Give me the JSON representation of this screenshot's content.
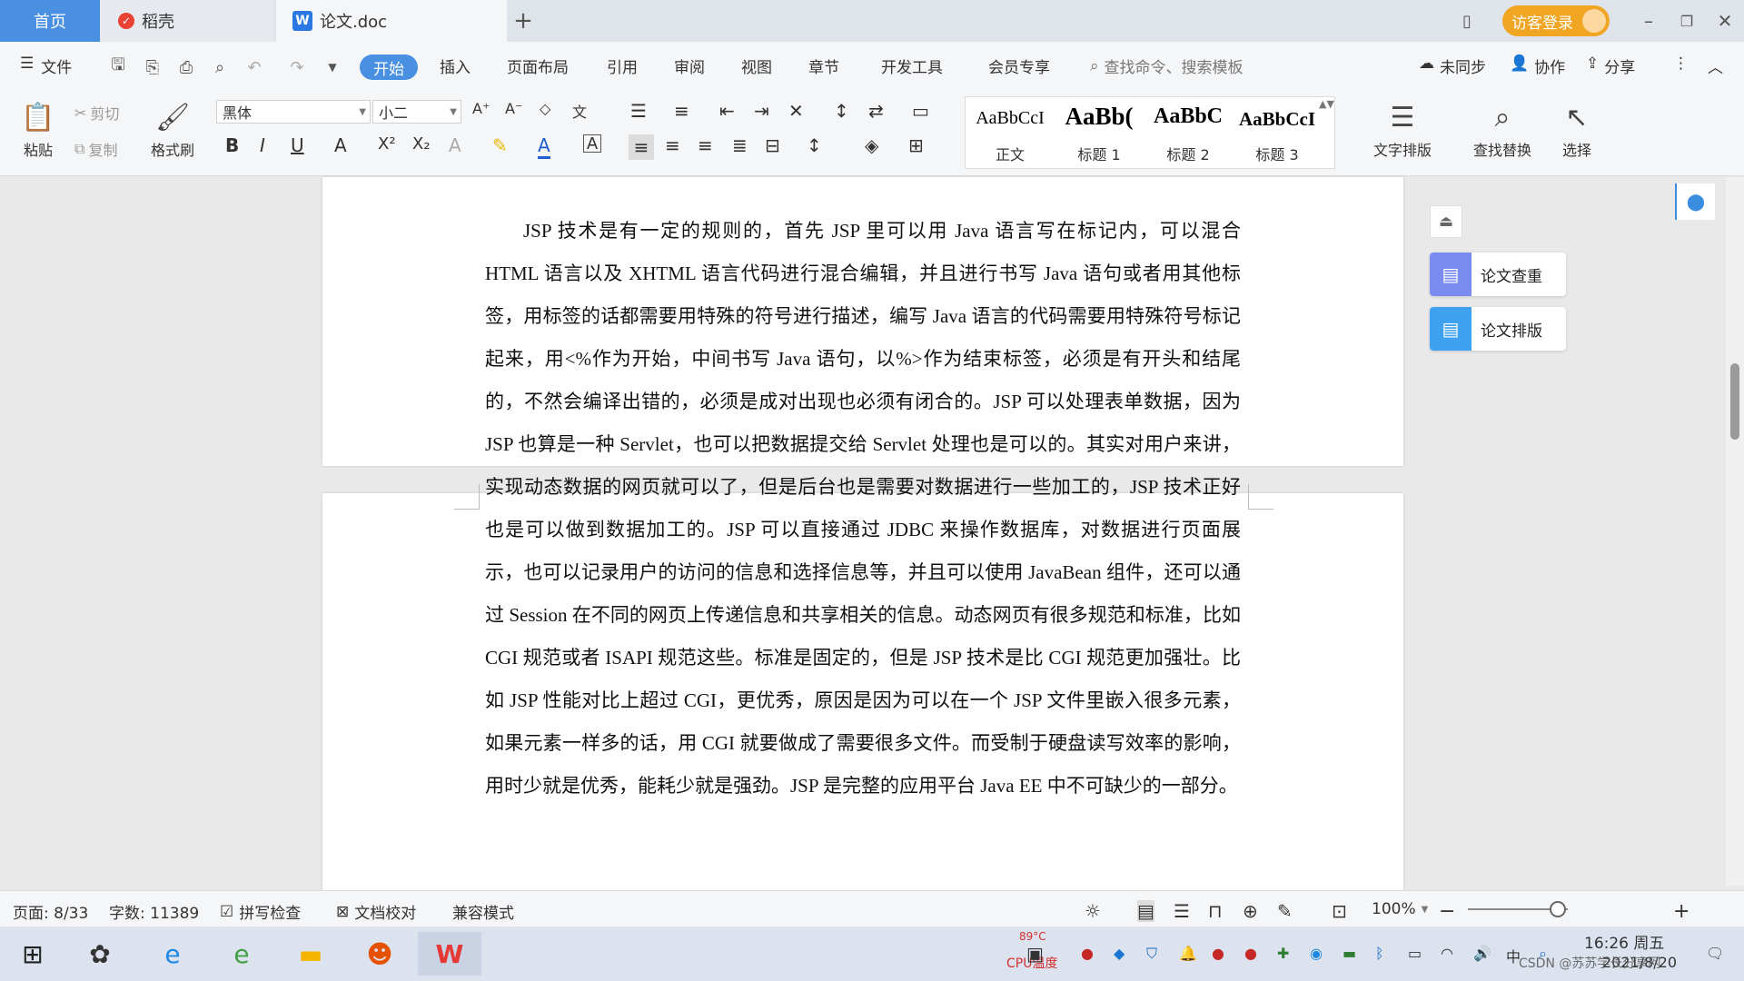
{
  "titlebar": {
    "tabs": [
      {
        "label": "首页"
      },
      {
        "label": "稻壳"
      },
      {
        "label": "论文.doc"
      }
    ],
    "new_tab": "+",
    "login_label": "访客登录"
  },
  "menubar": {
    "file": "文件",
    "items": [
      "开始",
      "插入",
      "页面布局",
      "引用",
      "审阅",
      "视图",
      "章节",
      "开发工具",
      "会员专享"
    ],
    "search_placeholder": "查找命令、搜索模板",
    "sync": "未同步",
    "collab": "协作",
    "share": "分享"
  },
  "ribbon": {
    "paste": "粘贴",
    "cut": "剪切",
    "copy": "复制",
    "format_painter": "格式刷",
    "font_name": "黑体",
    "font_size": "小二",
    "styles": [
      {
        "preview": "AaBbCcI",
        "name": "正文"
      },
      {
        "preview": "AaBb(",
        "name": "标题 1"
      },
      {
        "preview": "AaBbC",
        "name": "标题 2"
      },
      {
        "preview": "AaBbCcI",
        "name": "标题 3"
      }
    ],
    "text_layout": "文字排版",
    "find_replace": "查找替换",
    "select": "选择"
  },
  "document": {
    "paragraph": "JSP 技术是有一定的规则的，首先 JSP 里可以用 Java 语言写在标记内，可以混合 HTML 语言以及 XHTML 语言代码进行混合编辑，并且进行书写 Java 语句或者用其他标签，用标签的话都需要用特殊的符号进行描述，编写 Java 语言的代码需要用特殊符号标记起来，用<%作为开始，中间书写 Java 语句，以%>作为结束标签，必须是有开头和结尾的，不然会编译出错的，必须是成对出现也必须有闭合的。JSP 可以处理表单数据，因为 JSP 也算是一种 Servlet，也可以把数据提交给 Servlet 处理也是可以的。其实对用户来讲，实现动态数据的网页就可以了，但是后台也是需要对数据进行一些加工的，JSP 技术正好也是可以做到数据加工的。JSP 可以直接通过 JDBC 来操作数据库，对数据进行页面展示，也可以记录用户的访问的信息和选择信息等，并且可以使用 JavaBean 组件，还可以通过 Session 在不同的网页上传递信息和共享相关的信息。动态网页有很多规范和标准，比如 CGI 规范或者 ISAPI 规范这些。标准是固定的，但是 JSP 技术是比 CGI 规范更加强壮。比如 JSP 性能对比上超过 CGI，更优秀，原因是因为可以在一个 JSP 文件里嵌入很多元素，如果元素一样多的话，用 CGI 就要做成了需要很多文件。而受制于硬盘读写效率的影响，用时少就是优秀，能耗少就是强劲。JSP 是完整的应用平台 Java EE 中不可缺少的一部分。"
  },
  "side_panel": {
    "check": "论文查重",
    "format": "论文排版"
  },
  "statusbar": {
    "page": "页面: 8/33",
    "words": "字数: 11389",
    "spell": "拼写检查",
    "proof": "文档校对",
    "compat": "兼容模式",
    "zoom": "100%"
  },
  "taskbar": {
    "time": "16:26 周五",
    "date": "2021/8/20",
    "ime": "中",
    "cpu_temp": "89°C",
    "cpu_label": "CPU温度",
    "watermark": "CSDN @苏苏学长分享网"
  }
}
